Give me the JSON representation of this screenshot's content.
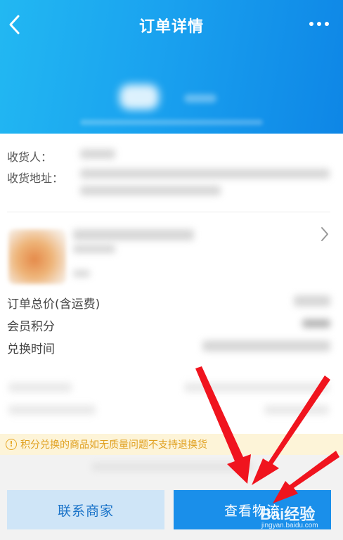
{
  "header": {
    "title": "订单详情",
    "back_icon": "chevron-left-icon",
    "more_icon": "more-dots-icon"
  },
  "address": {
    "recipient_label": "收货人：",
    "address_label": "收货地址："
  },
  "summary": {
    "total_label": "订单总价(含运费)",
    "points_label": "会员积分",
    "exchange_time_label": "兑换时间"
  },
  "notice": {
    "icon": "info-icon",
    "text": "积分兑换的商品如无质量问题不支持退换货"
  },
  "actions": {
    "contact_label": "联系商家",
    "logistics_label": "查看物流"
  },
  "watermark": {
    "text": "Bai经验",
    "sub": "jingyan.baidu.com"
  },
  "colors": {
    "header_gradient_start": "#22b8f2",
    "header_gradient_end": "#0e86e6",
    "primary_button": "#1a8fea",
    "secondary_button": "#cfe5f7",
    "notice_bg": "#fdf4d8",
    "notice_text": "#e0a020",
    "annotation_arrow": "#f0141e"
  }
}
